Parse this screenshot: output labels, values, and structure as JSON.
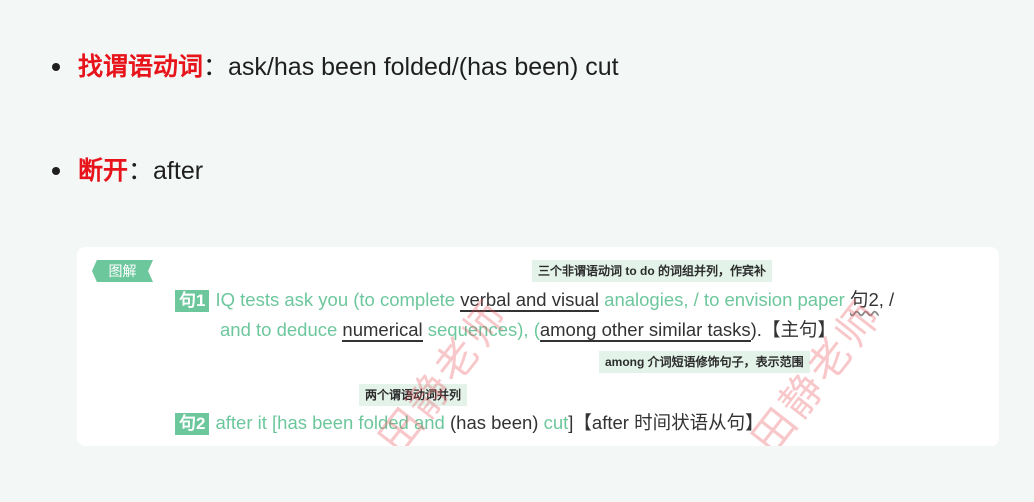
{
  "bullets": [
    {
      "key": "找谓语动词",
      "sep": "：",
      "text": "ask/has been folded/(has been) cut"
    },
    {
      "key": "断开",
      "sep": "：",
      "text": "after"
    }
  ],
  "card": {
    "tag": "图解",
    "notes": {
      "n1": "三个非谓语动词 to do 的词组并列，作宾补",
      "n2": "among 介词短语修饰句子，表示范围",
      "n3": "两个谓语动词并列"
    },
    "s1": {
      "label": "句1",
      "p1": "IQ tests ask you (to complete ",
      "u1": "verbal and visual",
      "p2": " analogies, / to envision paper ",
      "ref": "句2",
      "p3": ", /",
      "p4": "and to deduce ",
      "u2": "numerical",
      "p5": " sequences), (",
      "u3": "among other similar tasks",
      "p6": ").【主句】"
    },
    "s2": {
      "label": "句2",
      "p1": "after it [",
      "p2": "has been folded and",
      "p3": " (has been) ",
      "p4": "cut",
      "p5": "]【after 时间状语从句】"
    },
    "watermark": "田静老师"
  }
}
